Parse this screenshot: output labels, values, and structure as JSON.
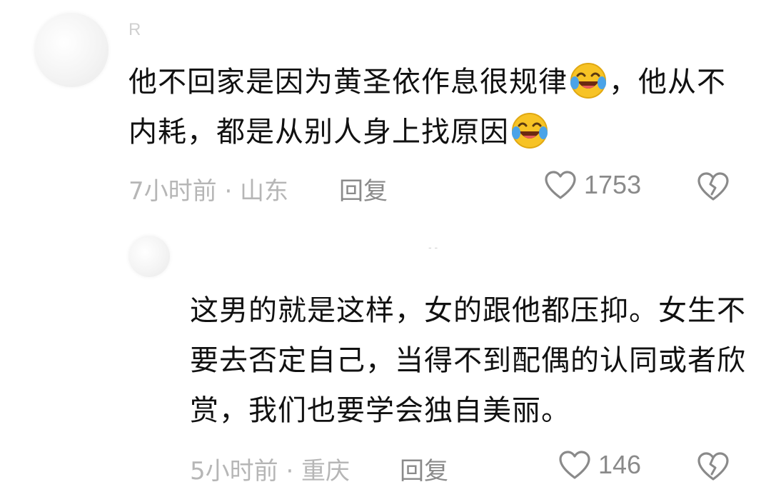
{
  "comments": [
    {
      "username": "R",
      "text_part1": "他不回家是因为黄圣依作息很规律",
      "text_part2": "，他从不内耗，都是从别人身上找原因",
      "emoji": "laughing-crying-emoji",
      "time": "7小时前 · 山东",
      "reply_label": "回复",
      "likes": "1753"
    },
    {
      "username": "- -",
      "text": "这男的就是这样，女的跟他都压抑。女生不要去否定自己，当得不到配偶的认同或者欣赏，我们也要学会独自美丽。",
      "time": "5小时前 · 重庆",
      "reply_label": "回复",
      "likes": "146"
    }
  ],
  "icons": {
    "like": "heart-outline-icon",
    "dislike": "broken-heart-icon"
  },
  "colors": {
    "text": "#111111",
    "meta": "#b6b6b6",
    "action": "#8a8a8a",
    "emoji_face": "#f7c325"
  }
}
